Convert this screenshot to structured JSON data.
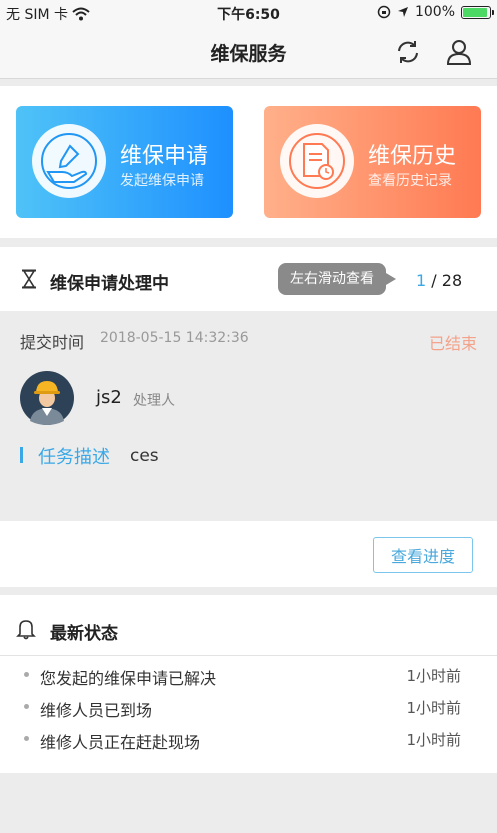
{
  "status_bar": {
    "carrier": "无 SIM 卡",
    "time": "下午6:50",
    "battery": "100%"
  },
  "nav": {
    "title": "维保服务",
    "refresh_icon": "refresh-icon",
    "user_icon": "user-icon"
  },
  "cards": [
    {
      "title": "维保申请",
      "subtitle": "发起维保申请",
      "icon": "hand-pen-icon",
      "color": "#2196f3"
    },
    {
      "title": "维保历史",
      "subtitle": "查看历史记录",
      "icon": "document-clock-icon",
      "color": "#ff7a52"
    }
  ],
  "processing": {
    "title": "维保申请处理中",
    "tooltip": "左右滑动查看",
    "current": "1",
    "separator": "/",
    "total": "28",
    "submit_label": "提交时间",
    "submit_time": "2018-05-15 14:32:36",
    "status": "已结束",
    "handler_name": "js2",
    "handler_role": "处理人",
    "task_label": "任务描述",
    "task_desc": "ces",
    "progress_button": "查看进度"
  },
  "latest": {
    "title": "最新状态",
    "items": [
      {
        "text": "您发起的维保申请已解决",
        "time": "1小时前"
      },
      {
        "text": "维修人员已到场",
        "time": "1小时前"
      },
      {
        "text": "维修人员正在赶赴现场",
        "time": "1小时前"
      }
    ]
  }
}
